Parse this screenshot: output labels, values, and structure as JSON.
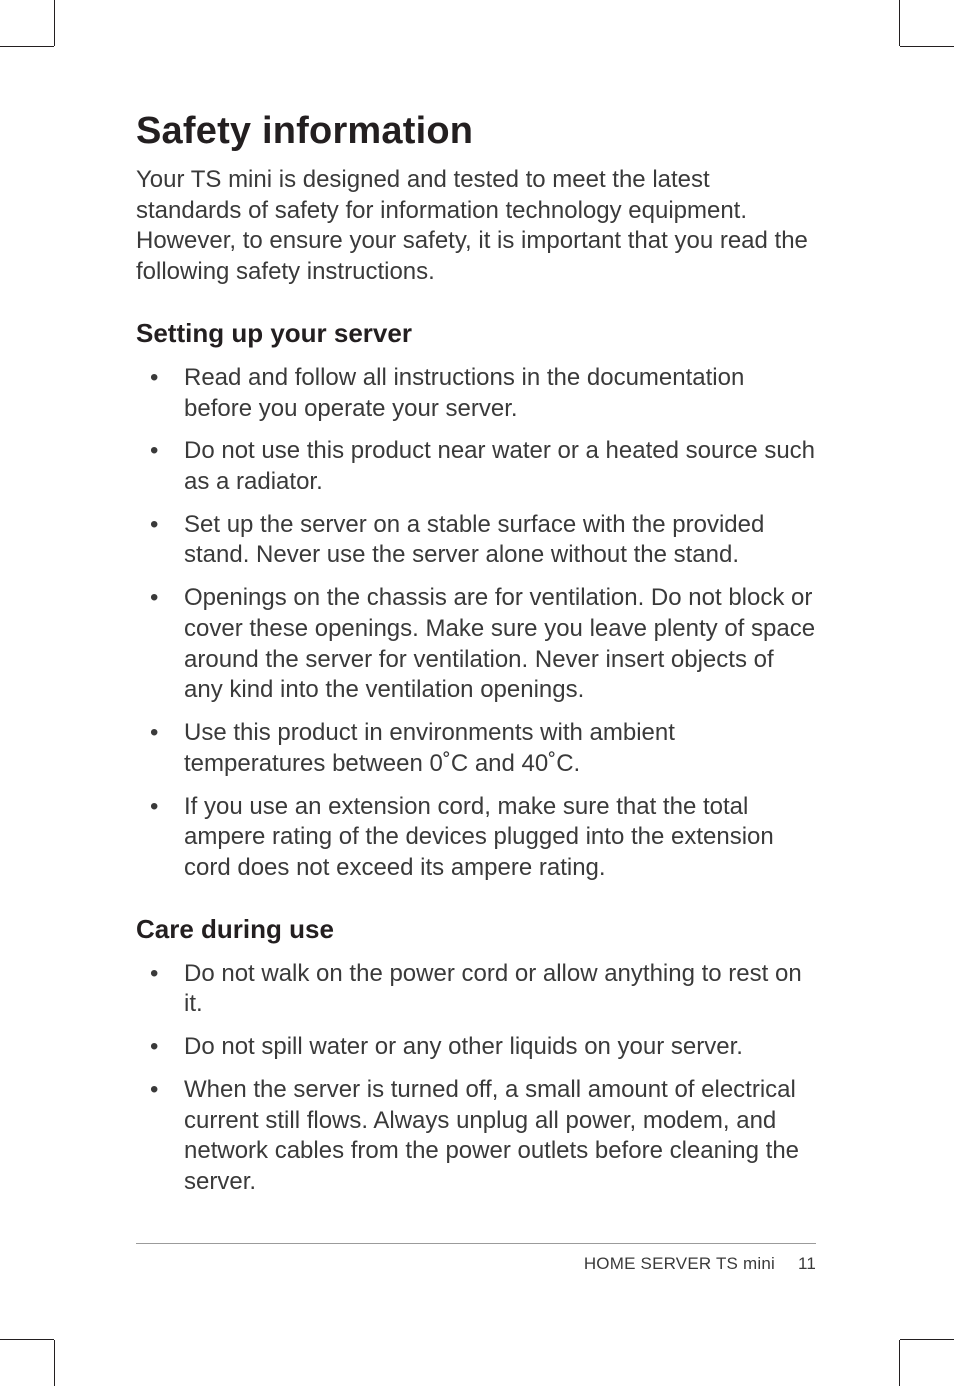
{
  "heading": "Safety information",
  "intro": "Your TS mini is designed and tested to meet the latest standards of safety for information technology equipment. However, to ensure your safety, it is important that you read the following safety instructions.",
  "sections": [
    {
      "title": "Setting up your server",
      "items": [
        "Read and follow all instructions in the documentation before you operate your server.",
        "Do not use this product near water or a heated source such as a radiator.",
        "Set up the server on a stable surface with the provided stand. Never use the server alone without the stand.",
        "Openings on the chassis are for ventilation. Do not block or cover these openings. Make sure you leave plenty of space around the server for ventilation. Never insert objects of any kind into the ventilation openings.",
        "Use this product in environments with ambient temperatures between 0˚C and 40˚C.",
        "If you use an extension cord, make sure that the total ampere rating of the devices plugged into the extension cord does not exceed its ampere rating."
      ]
    },
    {
      "title": "Care during use",
      "items": [
        "Do not walk on the power cord or allow anything to rest on it.",
        "Do not spill water or any other liquids on your server.",
        "When the server is turned off, a small amount of electrical current still flows. Always unplug all power, modem, and network cables from the power outlets before cleaning the server."
      ]
    }
  ],
  "footer": {
    "label": "HOME SERVER TS mini",
    "page": "11"
  }
}
